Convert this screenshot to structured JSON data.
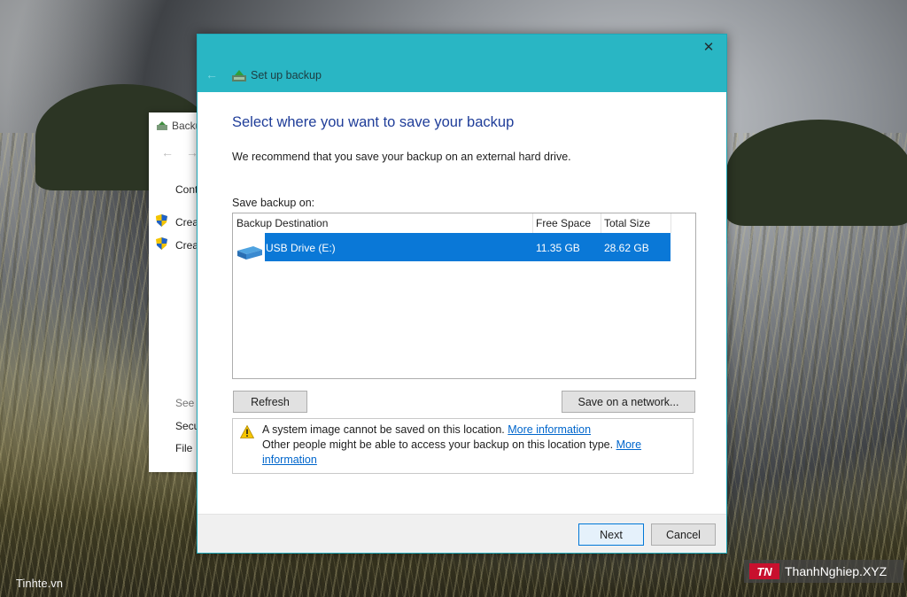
{
  "background_window": {
    "title": "Backu",
    "items": [
      "Conti",
      "Crea",
      "Crea"
    ],
    "see_also": "See",
    "links": [
      "Secu",
      "File"
    ]
  },
  "dialog": {
    "title": "Set up backup",
    "heading": "Select where you want to save your backup",
    "recommendation": "We recommend that you save your backup on an external hard drive.",
    "save_on_label": "Save backup on:",
    "table": {
      "columns": [
        "Backup Destination",
        "Free Space",
        "Total Size"
      ],
      "rows": [
        {
          "destination": "USB Drive (E:)",
          "free_space": "11.35 GB",
          "total_size": "28.62 GB",
          "selected": true
        }
      ]
    },
    "buttons": {
      "refresh": "Refresh",
      "save_network": "Save on a network...",
      "next": "Next",
      "cancel": "Cancel"
    },
    "warning": {
      "line1_text": "A system image cannot be saved on this location.",
      "line1_link": "More information",
      "line2_text": "Other people might be able to access your backup on this location type.",
      "line2_link_a": "More",
      "line2_link_b": "information"
    },
    "accent_color": "#29b6c4",
    "selection_color": "#0a78d7"
  },
  "watermarks": {
    "left": "Tinhte.vn",
    "right_logo": "TN",
    "right": "ThanhNghiep.XYZ"
  }
}
